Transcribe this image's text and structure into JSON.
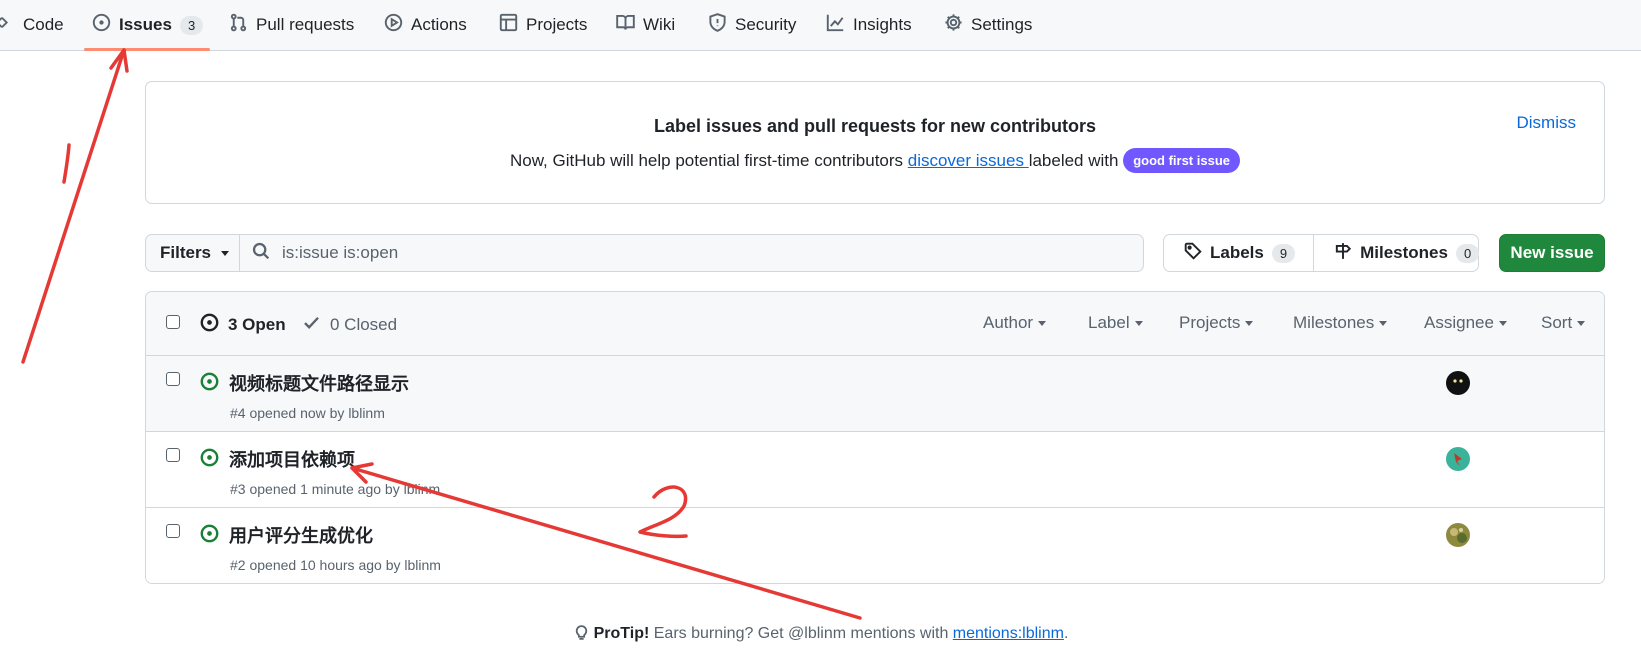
{
  "nav": {
    "tabs": [
      {
        "label": "Code",
        "icon": "code-icon"
      },
      {
        "label": "Issues",
        "icon": "issue-opened-icon",
        "count": "3",
        "active": true
      },
      {
        "label": "Pull requests",
        "icon": "git-pull-request-icon"
      },
      {
        "label": "Actions",
        "icon": "play-icon"
      },
      {
        "label": "Projects",
        "icon": "table-icon"
      },
      {
        "label": "Wiki",
        "icon": "book-icon"
      },
      {
        "label": "Security",
        "icon": "shield-icon"
      },
      {
        "label": "Insights",
        "icon": "graph-icon"
      },
      {
        "label": "Settings",
        "icon": "gear-icon"
      }
    ]
  },
  "banner": {
    "title": "Label issues and pull requests for new contributors",
    "text_before": "Now, GitHub will help potential first-time contributors ",
    "link": "discover issues ",
    "text_after": " labeled with ",
    "label": "good first issue",
    "label_color": "#7057ff",
    "dismiss": "Dismiss"
  },
  "toolbar": {
    "filters": "Filters",
    "search_value": "is:issue is:open",
    "labels": "Labels",
    "labels_count": "9",
    "milestones": "Milestones",
    "milestones_count": "0",
    "new_issue": "New issue",
    "new_issue_color": "#1f883d"
  },
  "list": {
    "open_label": "3 Open",
    "closed_label": "0 Closed",
    "filters": [
      "Author",
      "Label",
      "Projects",
      "Milestones",
      "Assignee",
      "Sort"
    ],
    "issues": [
      {
        "title": "视频标题文件路径显示",
        "meta": "#4 opened now by lblinm",
        "avatar_color": "#111111"
      },
      {
        "title": "添加项目依赖项",
        "meta": "#3 opened 1 minute ago by lblinm",
        "avatar_color": "#3bb39a"
      },
      {
        "title": "用户评分生成优化",
        "meta": "#2 opened 10 hours ago by lblinm",
        "avatar_color": "#8d8a3e"
      }
    ]
  },
  "protip": {
    "label": "ProTip!",
    "text": " Ears burning? Get @lblinm mentions with ",
    "link": "mentions:lblinm",
    "end": "."
  },
  "annotations": {
    "color": "#e53935"
  }
}
